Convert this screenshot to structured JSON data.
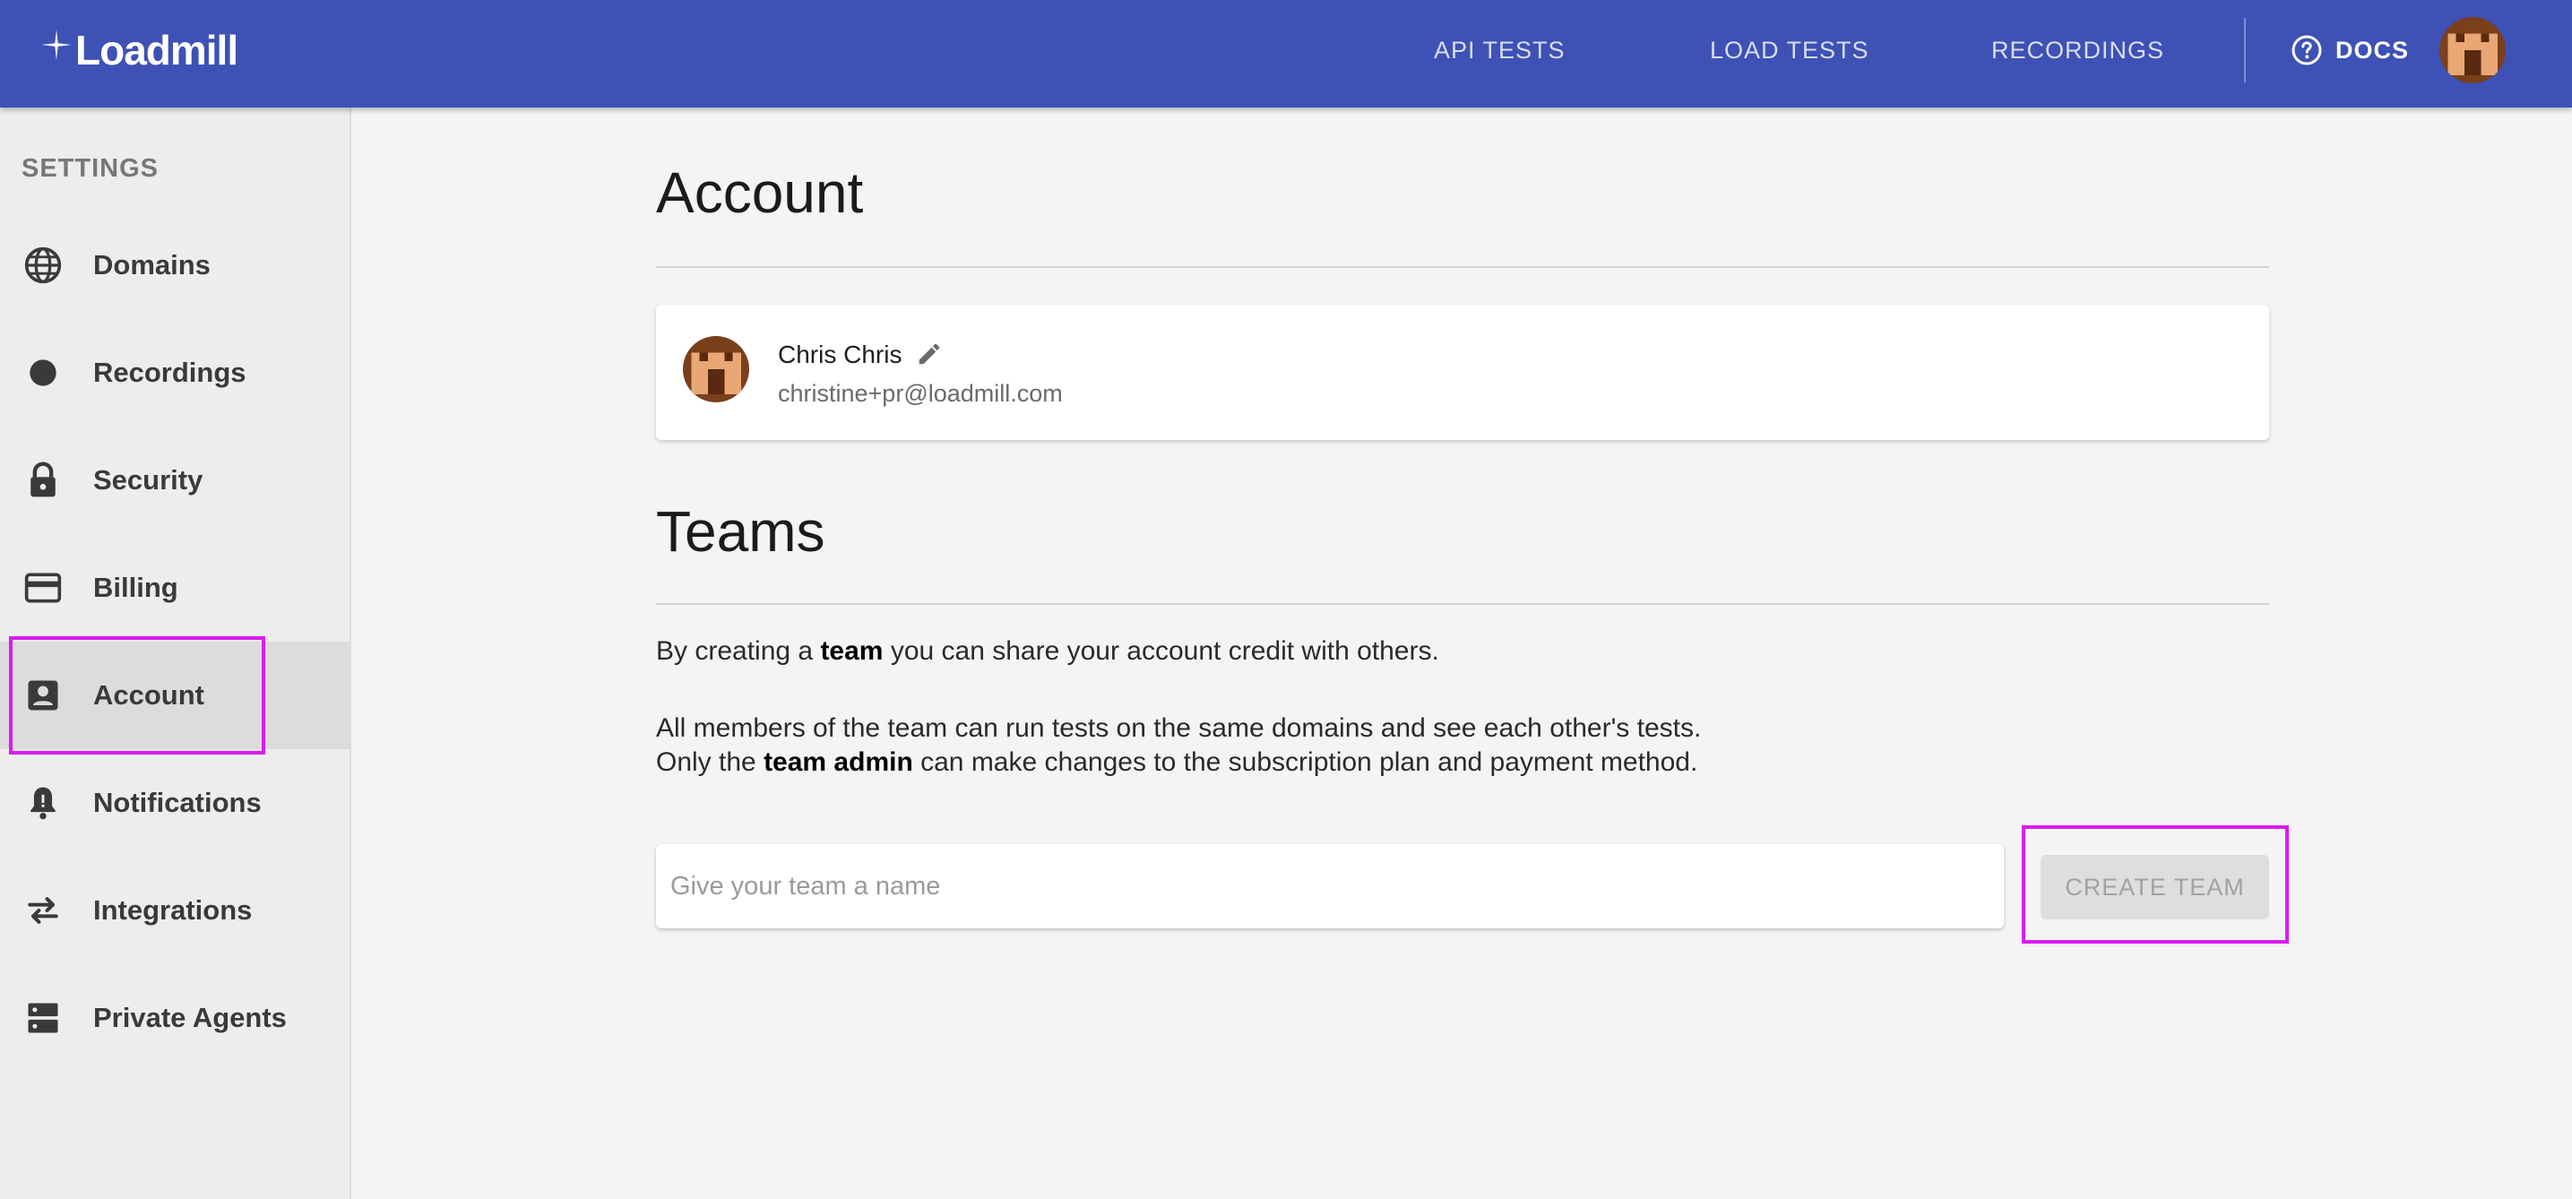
{
  "brand": {
    "name": "Loadmill"
  },
  "header": {
    "nav": [
      {
        "label": "API TESTS"
      },
      {
        "label": "LOAD TESTS"
      },
      {
        "label": "RECORDINGS"
      }
    ],
    "docs_label": "DOCS",
    "docs_icon": "help-circle-icon",
    "avatar_icon": "pixel-avatar-icon"
  },
  "sidebar": {
    "heading": "SETTINGS",
    "active_item": "Account",
    "items": [
      {
        "label": "Domains",
        "icon": "globe-icon"
      },
      {
        "label": "Recordings",
        "icon": "record-dot-icon"
      },
      {
        "label": "Security",
        "icon": "lock-icon"
      },
      {
        "label": "Billing",
        "icon": "credit-card-icon"
      },
      {
        "label": "Account",
        "icon": "account-box-icon"
      },
      {
        "label": "Notifications",
        "icon": "bell-icon"
      },
      {
        "label": "Integrations",
        "icon": "swap-arrows-icon"
      },
      {
        "label": "Private Agents",
        "icon": "server-icon"
      }
    ]
  },
  "main": {
    "account_title": "Account",
    "profile": {
      "name": "Chris Chris",
      "email": "christine+pr@loadmill.com"
    },
    "teams_title": "Teams",
    "para1": {
      "before": "By creating a ",
      "bold": "team",
      "after": " you can share your account credit with others."
    },
    "para2": "All members of the team can run tests on the same domains and see each other's tests.",
    "para3": {
      "before": "Only the ",
      "bold": "team admin",
      "after": " can make changes to the subscription plan and payment method."
    },
    "team_input": {
      "value": "",
      "placeholder": "Give your team a name"
    },
    "create_button": "CREATE TEAM"
  },
  "colors": {
    "header_bg": "#3e51b5",
    "highlight": "#d91bf0",
    "page_bg": "#f4f4f4",
    "sidebar_bg": "#ededed"
  }
}
